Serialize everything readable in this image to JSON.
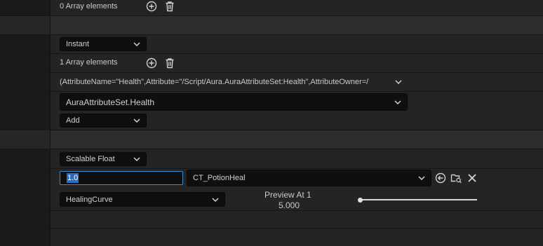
{
  "rows": {
    "array1": {
      "count_label": "0 Array elements"
    },
    "duration": {
      "selected": "Instant"
    },
    "array2": {
      "count_label": "1 Array elements"
    },
    "attribute": {
      "summary": "(AttributeName=\"Health\",Attribute=\"/Script/Aura.AuraAttributeSet:Health\",AttributeOwner=/"
    },
    "attribute_picker": {
      "selected": "AuraAttributeSet.Health"
    },
    "modifier_op": {
      "selected": "Add"
    },
    "magnitude_type": {
      "selected": "Scalable Float"
    },
    "scalable": {
      "value": "1.0",
      "curve_table": "CT_PotionHeal",
      "row_name": "HealingCurve",
      "preview_label": "Preview At 1",
      "preview_value": "5.000",
      "preview_level_fraction": 0
    }
  },
  "icons": [
    "add-element-icon",
    "delete-all-icon",
    "chevron-down-icon",
    "reset-arrow-icon",
    "browse-folder-icon",
    "clear-x-icon"
  ],
  "colors": {
    "background": "#242424",
    "field": "#0f0f0f",
    "focus": "#2e8fd8",
    "selection": "#2a6cc0"
  }
}
